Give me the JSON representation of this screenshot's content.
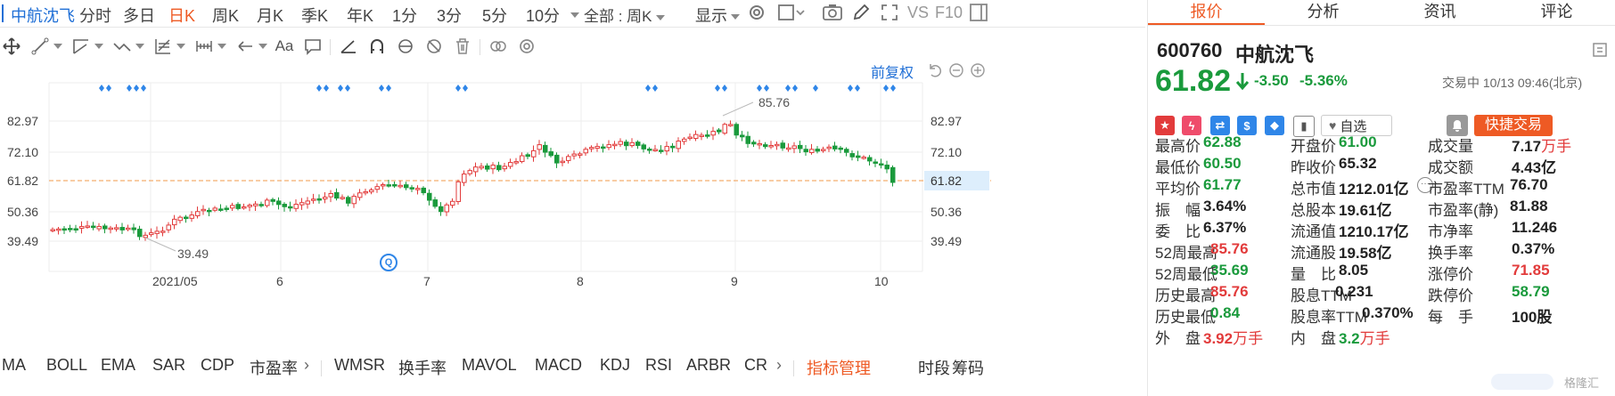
{
  "toolbar": {
    "stock_name": "中航沈飞",
    "periods": [
      "分时",
      "多日",
      "日K",
      "周K",
      "月K",
      "季K",
      "年K",
      "1分",
      "3分",
      "5分",
      "10分"
    ],
    "active_period": "日K",
    "range_select": "全部 : 周K",
    "display_label": "显示",
    "vs_label": "VS",
    "f10_label": "F10"
  },
  "chart": {
    "adjust_label": "前复权",
    "price_ticks": [
      "82.97",
      "72.10",
      "61.82",
      "50.36",
      "39.49"
    ],
    "current_price_tag": "61.82",
    "date_labels": [
      "2021/05",
      "6",
      "7",
      "8",
      "9",
      "10"
    ],
    "high_annotation": "85.76",
    "low_annotation": "39.49",
    "marker_badge": "Q"
  },
  "indicators": {
    "items": [
      "MA",
      "BOLL",
      "EMA",
      "SAR",
      "CDP",
      "市盈率",
      "WMSR",
      "换手率",
      "MAVOL",
      "MACD",
      "KDJ",
      "RSI",
      "ARBR",
      "CR"
    ],
    "manage_label": "指标管理",
    "right_items": [
      "时段",
      "筹码"
    ]
  },
  "panel": {
    "tabs": [
      "报价",
      "分析",
      "资讯",
      "评论"
    ],
    "active_tab": "报价",
    "code": "600760",
    "name": "中航沈飞",
    "price": "61.82",
    "change": "-3.50",
    "change_pct": "-5.36%",
    "status": "交易中 10/13 09:46(北京)",
    "watchlist_label": "自选",
    "quick_trade_label": "快捷交易",
    "stats": [
      {
        "label": "最高价",
        "value": "62.88",
        "tone": "down"
      },
      {
        "label": "开盘价",
        "value": "61.00",
        "tone": "down"
      },
      {
        "label": "成交量",
        "value": "7.17",
        "unit": "万手",
        "tone": "plain"
      },
      {
        "label": "最低价",
        "value": "60.50",
        "tone": "down"
      },
      {
        "label": "昨收价",
        "value": "65.32",
        "tone": "plain"
      },
      {
        "label": "成交额",
        "value": "4.43亿",
        "tone": "plain"
      },
      {
        "label": "平均价",
        "value": "61.77",
        "tone": "down"
      },
      {
        "label": "总市值",
        "value": "1212.01亿",
        "tone": "plain"
      },
      {
        "label": "市盈率TTM",
        "value": "76.70",
        "tone": "plain"
      },
      {
        "label": "振　幅",
        "value": "3.64%",
        "tone": "plain"
      },
      {
        "label": "总股本",
        "value": "19.61亿",
        "tone": "plain"
      },
      {
        "label": "市盈率(静)",
        "value": "81.88",
        "tone": "plain"
      },
      {
        "label": "委　比",
        "value": "6.37%",
        "tone": "plain"
      },
      {
        "label": "流通值",
        "value": "1210.17亿",
        "tone": "plain"
      },
      {
        "label": "市净率",
        "value": "11.246",
        "tone": "plain"
      },
      {
        "label": "52周最高",
        "value": "85.76",
        "tone": "up"
      },
      {
        "label": "流通股",
        "value": "19.58亿",
        "tone": "plain"
      },
      {
        "label": "换手率",
        "value": "0.37%",
        "tone": "plain"
      },
      {
        "label": "52周最低",
        "value": "35.69",
        "tone": "down"
      },
      {
        "label": "量　比",
        "value": "8.05",
        "tone": "plain"
      },
      {
        "label": "涨停价",
        "value": "71.85",
        "tone": "up"
      },
      {
        "label": "历史最高",
        "value": "85.76",
        "tone": "up"
      },
      {
        "label": "股息TTM",
        "value": "0.231",
        "tone": "plain"
      },
      {
        "label": "跌停价",
        "value": "58.79",
        "tone": "down"
      },
      {
        "label": "历史最低",
        "value": "0.84",
        "tone": "down"
      },
      {
        "label": "股息率TTM",
        "value": "0.370%",
        "tone": "plain"
      },
      {
        "label": "每　手",
        "value": "100股",
        "tone": "plain"
      },
      {
        "label": "外　盘",
        "value": "3.92",
        "unit": "万手",
        "tone": "up"
      },
      {
        "label": "内　盘",
        "value": "3.2",
        "unit": "万手",
        "tone": "down"
      }
    ],
    "watermark": "格隆汇"
  },
  "colors": {
    "accent": "#ee5a24",
    "up": "#e23b3b",
    "down": "#1a9a3c",
    "link": "#1f6fd6",
    "price_line": "#f29a4b"
  }
}
